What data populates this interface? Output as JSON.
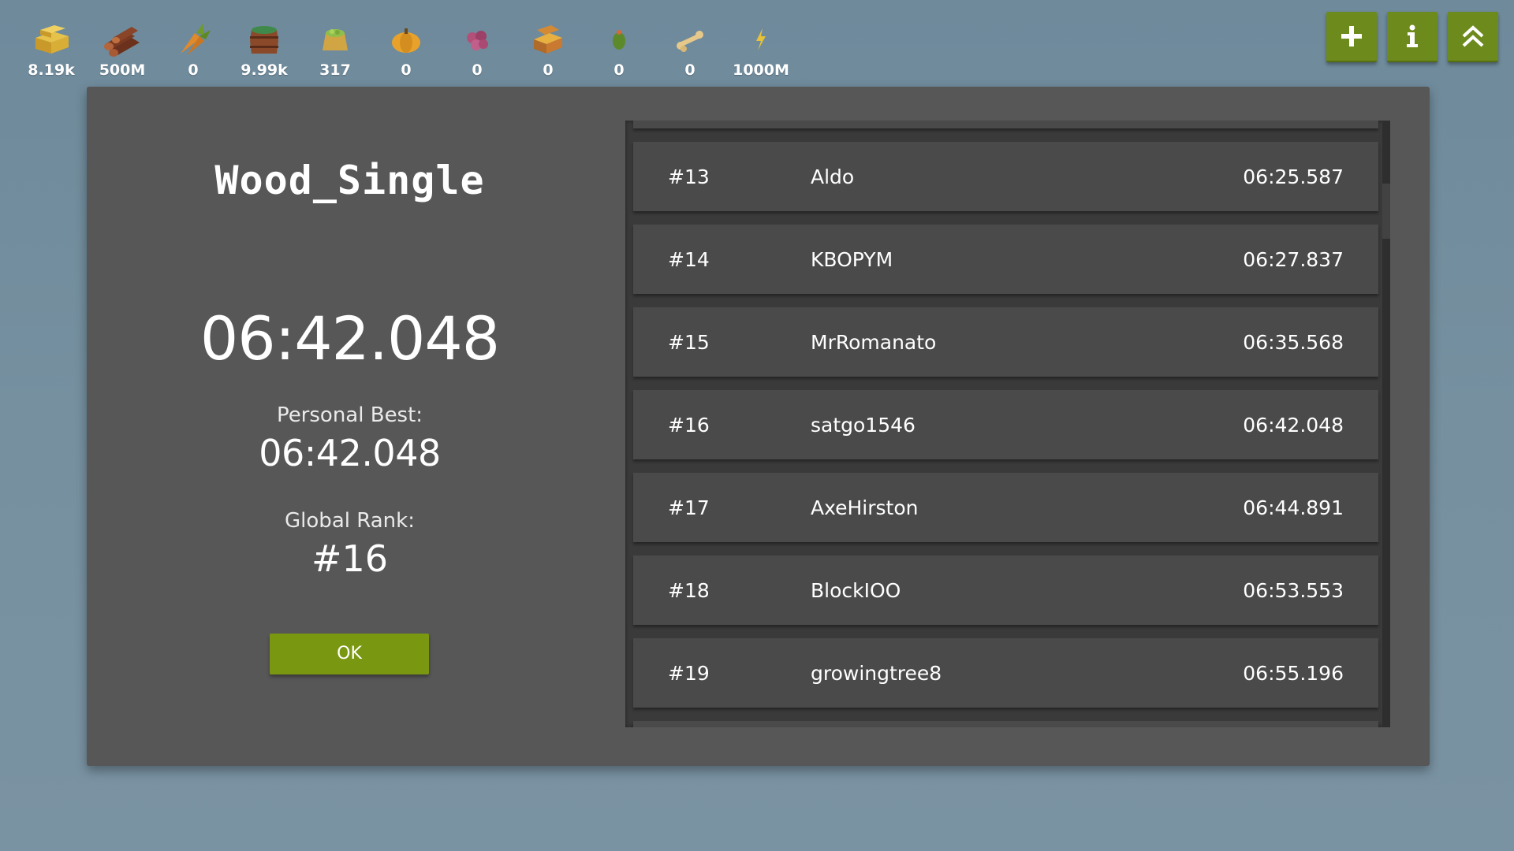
{
  "resources": [
    {
      "icon": "hay-bale-icon",
      "count": "8.19k"
    },
    {
      "icon": "logs-icon",
      "count": "500M"
    },
    {
      "icon": "carrot-icon",
      "count": "0"
    },
    {
      "icon": "barrel-icon",
      "count": "9.99k"
    },
    {
      "icon": "sack-icon",
      "count": "317"
    },
    {
      "icon": "pumpkin-icon",
      "count": "0"
    },
    {
      "icon": "berries-icon",
      "count": "0"
    },
    {
      "icon": "treasure-chest-icon",
      "count": "0"
    },
    {
      "icon": "cactus-icon",
      "count": "0"
    },
    {
      "icon": "bone-icon",
      "count": "0"
    },
    {
      "icon": "lightning-icon",
      "count": "1000M"
    }
  ],
  "top_buttons": [
    {
      "name": "add-button",
      "icon": "plus-icon"
    },
    {
      "name": "info-button",
      "icon": "info-icon"
    },
    {
      "name": "collapse-button",
      "icon": "double-chevron-up-icon"
    }
  ],
  "result": {
    "level_title": "Wood_Single",
    "run_time": "06:42.048",
    "personal_best_label": "Personal Best:",
    "personal_best": "06:42.048",
    "global_rank_label": "Global Rank:",
    "global_rank": "#16",
    "ok_label": "OK"
  },
  "leaderboard": [
    {
      "rank": "#13",
      "name": "Aldo",
      "time": "06:25.587"
    },
    {
      "rank": "#14",
      "name": "KBOPYM",
      "time": "06:27.837"
    },
    {
      "rank": "#15",
      "name": "MrRomanato",
      "time": "06:35.568"
    },
    {
      "rank": "#16",
      "name": "satgo1546",
      "time": "06:42.048"
    },
    {
      "rank": "#17",
      "name": "AxeHirston",
      "time": "06:44.891"
    },
    {
      "rank": "#18",
      "name": "BlockIOO",
      "time": "06:53.553"
    },
    {
      "rank": "#19",
      "name": "growingtree8",
      "time": "06:55.196"
    }
  ],
  "colors": {
    "accent_green": "#7a9712",
    "button_green": "#6d8a1c",
    "panel": "#575757",
    "row": "#4a4a4a"
  }
}
